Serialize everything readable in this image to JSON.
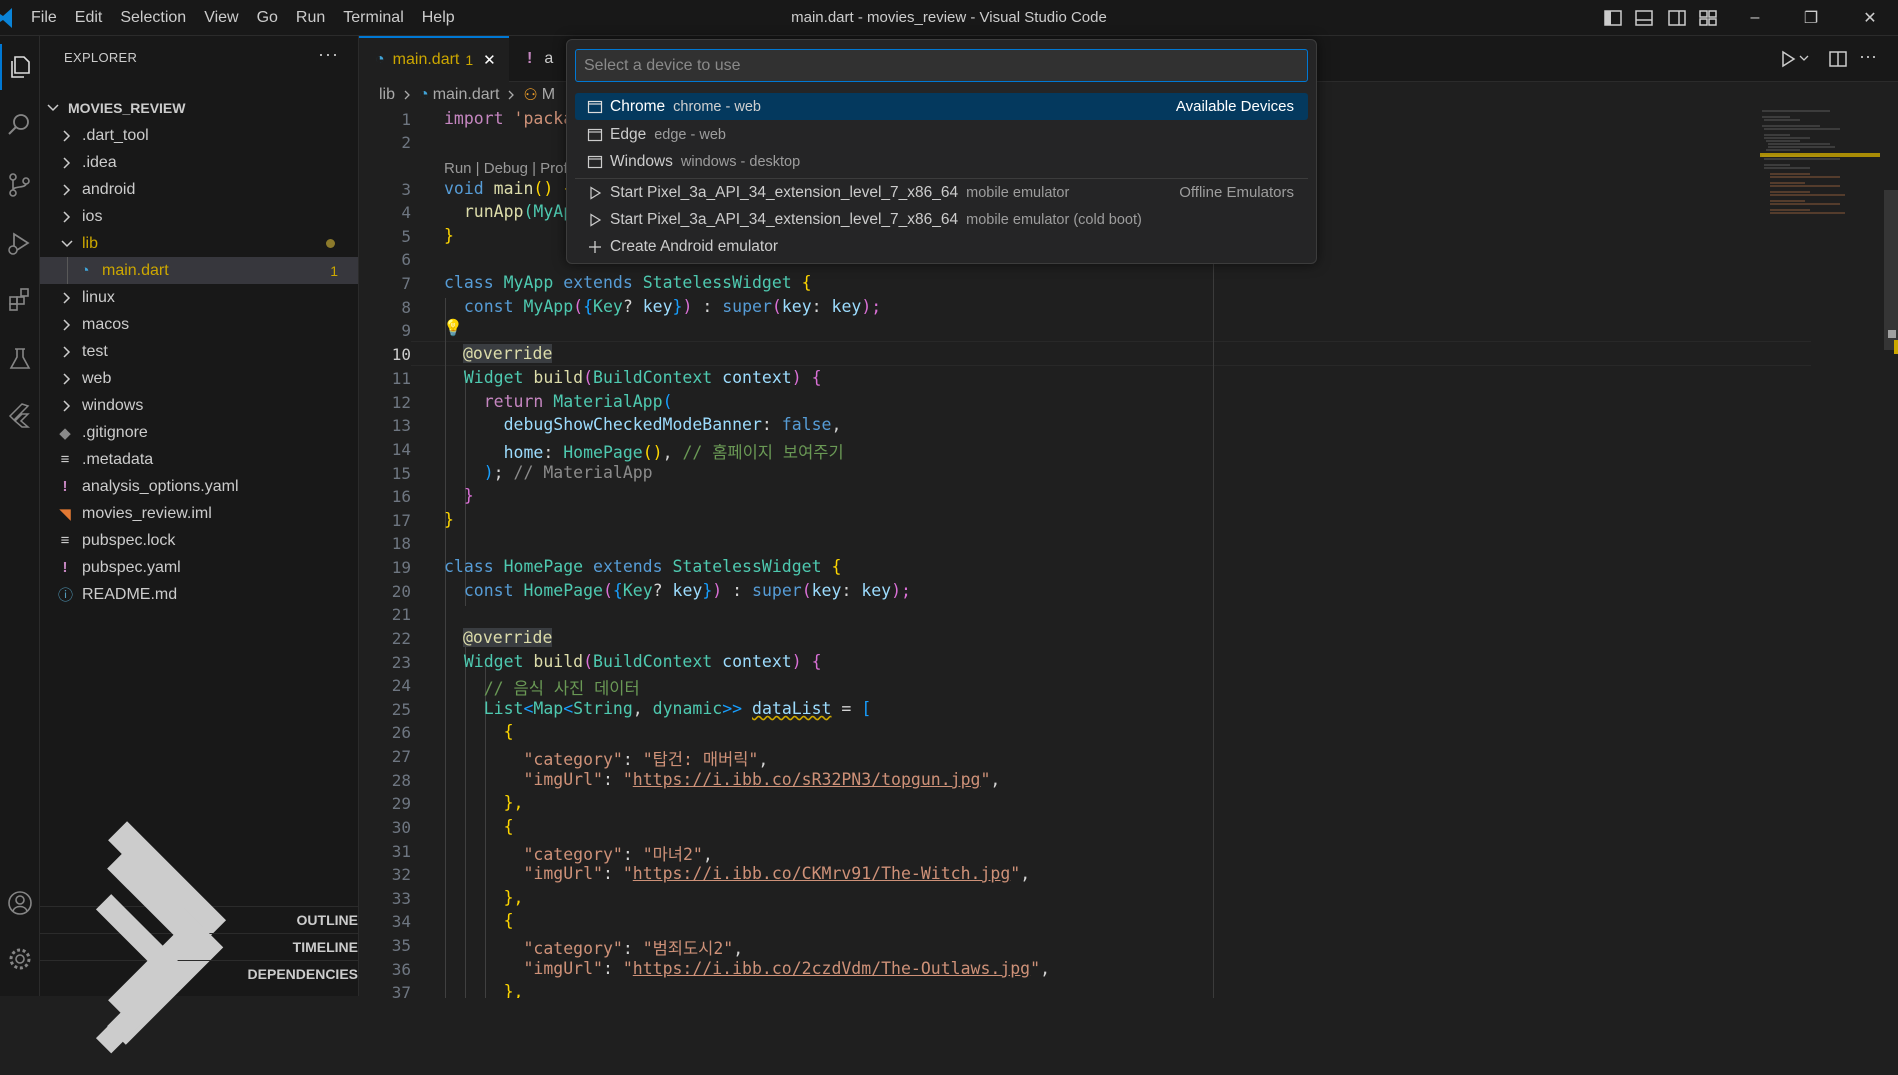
{
  "window": {
    "title": "main.dart - movies_review - Visual Studio Code",
    "menu": [
      "File",
      "Edit",
      "Selection",
      "View",
      "Go",
      "Run",
      "Terminal",
      "Help"
    ],
    "controls": [
      "–",
      "❐",
      "✕"
    ]
  },
  "explorer": {
    "header": "EXPLORER",
    "more": "···",
    "root": "MOVIES_REVIEW",
    "items": [
      {
        "label": ".dart_tool",
        "kind": "folder"
      },
      {
        "label": ".idea",
        "kind": "folder"
      },
      {
        "label": "android",
        "kind": "folder"
      },
      {
        "label": "ios",
        "kind": "folder"
      },
      {
        "label": "lib",
        "kind": "folder-open"
      },
      {
        "label": "main.dart",
        "kind": "dart-file",
        "badge": "1"
      },
      {
        "label": "linux",
        "kind": "folder"
      },
      {
        "label": "macos",
        "kind": "folder"
      },
      {
        "label": "test",
        "kind": "folder"
      },
      {
        "label": "web",
        "kind": "folder"
      },
      {
        "label": "windows",
        "kind": "folder"
      },
      {
        "label": ".gitignore",
        "kind": "git-file"
      },
      {
        "label": ".metadata",
        "kind": "text-file"
      },
      {
        "label": "analysis_options.yaml",
        "kind": "yaml-file"
      },
      {
        "label": "movies_review.iml",
        "kind": "rss-file"
      },
      {
        "label": "pubspec.lock",
        "kind": "text-file"
      },
      {
        "label": "pubspec.yaml",
        "kind": "yaml-file"
      },
      {
        "label": "README.md",
        "kind": "info-file"
      }
    ],
    "sections": [
      "OUTLINE",
      "TIMELINE",
      "DEPENDENCIES"
    ]
  },
  "tabs": [
    {
      "label": "main.dart",
      "badge": "1",
      "close": "✕"
    },
    {
      "label": "a",
      "warn": "!"
    }
  ],
  "breadcrumb": {
    "folder": "lib",
    "file": "main.dart",
    "symbol": "M"
  },
  "editor": {
    "line_numbers": [
      "1",
      "2",
      "3",
      "4",
      "5",
      "6",
      "7",
      "8",
      "9",
      "10",
      "11",
      "12",
      "13",
      "14",
      "15",
      "16",
      "17",
      "18",
      "19",
      "20",
      "21",
      "22",
      "23",
      "24",
      "25",
      "26",
      "27",
      "28",
      "29",
      "30",
      "31",
      "32",
      "33",
      "34",
      "35",
      "36",
      "37"
    ],
    "codelens": "Run | Debug | Prof",
    "code": {
      "l1a": "import",
      "l1b": " 'packa",
      "l3a": "void",
      "l3b": " main",
      "l3c": "() {",
      "l4a": "  runApp",
      "l4b": "(MyAp",
      "l5": "}",
      "l7a": "class",
      "l7b": " MyApp",
      "l7c": " extends",
      "l7d": " StatelessWidget",
      "l7e": " {",
      "l8a": "  const",
      "l8b": " MyApp",
      "l8c": "(",
      "l8d": "{",
      "l8e": "Key",
      "l8f": "?",
      "l8g": " key",
      "l8h": "}",
      "l8i": ")",
      "l8j": " : ",
      "l8k": "super",
      "l8l": "(",
      "l8m": "key",
      "l8n": ": ",
      "l8o": "key",
      "l8p": ");",
      "l10": "@override",
      "l11a": "  Widget",
      "l11b": " build",
      "l11c": "(",
      "l11d": "BuildContext",
      "l11e": " context",
      "l11f": ")",
      "l11g": " {",
      "l12a": "    return",
      "l12b": " MaterialApp",
      "l12c": "(",
      "l13a": "      debugShowCheckedModeBanner",
      "l13b": ": ",
      "l13c": "false",
      "l13d": ",",
      "l14a": "      home",
      "l14b": ": ",
      "l14c": "HomePage",
      "l14d": "()",
      "l14e": ", ",
      "l14f": "// 홈페이지 보여주기",
      "l15a": "    )",
      "l15b": ";",
      "l15c": " // MaterialApp",
      "l16": "  }",
      "l17": "}",
      "l19a": "class",
      "l19b": " HomePage",
      "l19c": " extends",
      "l19d": " StatelessWidget",
      "l19e": " {",
      "l20a": "  const",
      "l20b": " HomePage",
      "l20c": "(",
      "l20d": "{",
      "l20e": "Key",
      "l20f": "?",
      "l20g": " key",
      "l20h": "}",
      "l20i": ")",
      "l20j": " : ",
      "l20k": "super",
      "l20l": "(",
      "l20m": "key",
      "l20n": ": ",
      "l20o": "key",
      "l20p": ");",
      "l22": "@override",
      "l23a": "  Widget",
      "l23b": " build",
      "l23c": "(",
      "l23d": "BuildContext",
      "l23e": " context",
      "l23f": ")",
      "l23g": " {",
      "l24": "    // 음식 사진 데이터",
      "l25a": "    List",
      "l25b": "<",
      "l25c": "Map",
      "l25d": "<",
      "l25e": "String",
      "l25f": ", ",
      "l25g": "dynamic",
      "l25h": ">>",
      "l25i": " ",
      "l25j": "dataList",
      "l25k": " = ",
      "l25l": "[",
      "l26": "      {",
      "l27a": "        \"category\"",
      "l27b": ": ",
      "l27c": "\"탑건: 매버릭\"",
      "l27d": ",",
      "l28a": "        \"imgUrl\"",
      "l28b": ": ",
      "l28c": "\"",
      "l28d": "https://i.ibb.co/sR32PN3/topgun.jpg",
      "l28e": "\"",
      "l28f": ",",
      "l29": "      },",
      "l30": "      {",
      "l31a": "        \"category\"",
      "l31b": ": ",
      "l31c": "\"마녀2\"",
      "l31d": ",",
      "l32a": "        \"imgUrl\"",
      "l32b": ": ",
      "l32c": "\"",
      "l32d": "https://i.ibb.co/CKMrv91/The-Witch.jpg",
      "l32e": "\"",
      "l32f": ",",
      "l33": "      },",
      "l34": "      {",
      "l35a": "        \"category\"",
      "l35b": ": ",
      "l35c": "\"범죄도시2\"",
      "l35d": ",",
      "l36a": "        \"imgUrl\"",
      "l36b": ": ",
      "l36c": "\"",
      "l36d": "https://i.ibb.co/2czdVdm/The-Outlaws.jpg",
      "l36e": "\"",
      "l36f": ",",
      "l37": "      },"
    }
  },
  "quickpick": {
    "placeholder": "Select a device to use",
    "items": [
      {
        "label": "Chrome",
        "desc": "chrome - web",
        "group": "Available Devices",
        "icon": "device-icon"
      },
      {
        "label": "Edge",
        "desc": "edge - web",
        "icon": "device-icon"
      },
      {
        "label": "Windows",
        "desc": "windows - desktop",
        "icon": "device-icon"
      },
      {
        "label": "Start Pixel_3a_API_34_extension_level_7_x86_64",
        "desc": "mobile emulator",
        "group": "Offline Emulators",
        "icon": "play-icon"
      },
      {
        "label": "Start Pixel_3a_API_34_extension_level_7_x86_64",
        "desc": "mobile emulator (cold boot)",
        "icon": "play-icon"
      },
      {
        "label": "Create Android emulator",
        "desc": "",
        "icon": "add-icon"
      }
    ]
  },
  "colors": {
    "accent": "#0078d4",
    "selection": "#04395e",
    "warning": "#cca700"
  }
}
